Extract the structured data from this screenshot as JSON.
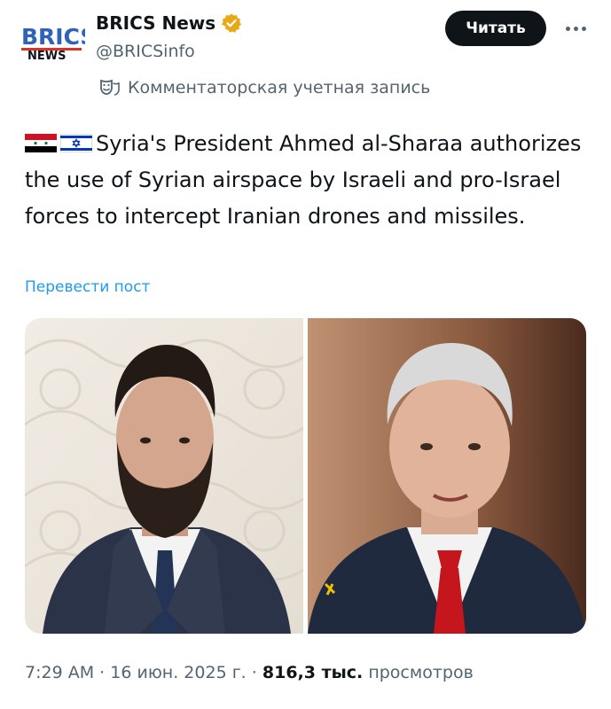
{
  "author": {
    "logo_text_top": "BRICS",
    "logo_text_bottom": "NEWS",
    "display_name": "BRICS News",
    "handle": "@BRICSinfo"
  },
  "follow_label": "Читать",
  "account_label": "Комментаторская учетная запись",
  "tweet": {
    "flags": [
      "flag-syria-icon",
      "flag-israel-icon"
    ],
    "text": "Syria's President Ahmed al-Sharaa authorizes the use of Syrian airspace by Israeli and pro-Israel forces to intercept Iranian drones and missiles."
  },
  "translate_label": "Перевести пост",
  "meta": {
    "time": "7:29 AM",
    "date": "16 июн. 2025 г.",
    "views_count": "816,3 тыс.",
    "views_label": "просмотров",
    "separator": "·"
  },
  "colors": {
    "brand_text": "#0f1419",
    "muted": "#536471",
    "link": "#1d9bf0",
    "verified_gold": "#e9a816",
    "logo_blue": "#2f63b7",
    "logo_red": "#d8352a",
    "logo_green": "#2a9d48",
    "logo_yellow": "#f1b517"
  }
}
